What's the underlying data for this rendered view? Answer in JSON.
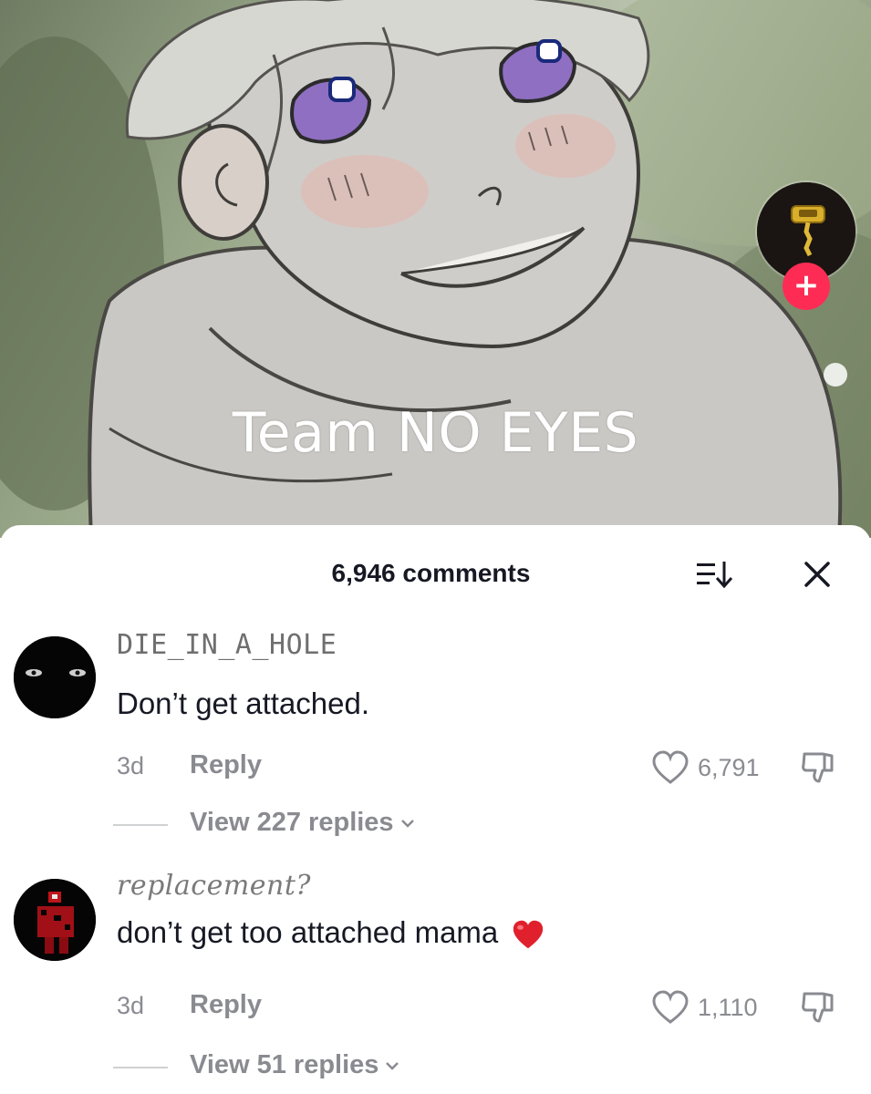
{
  "video": {
    "overlay_text": "Team NO EYES",
    "follow_label": "+"
  },
  "comments_panel": {
    "count_label": "6,946 comments",
    "close_label": "✕"
  },
  "comments": [
    {
      "username": "DIE_IN_A_HOLE",
      "text": "Don’t get attached.",
      "time": "3d",
      "reply_label": "Reply",
      "likes": "6,791",
      "view_replies": "View 227 replies"
    },
    {
      "username": "replacement?",
      "text": "don’t get too attached mama",
      "time": "3d",
      "reply_label": "Reply",
      "likes": "1,110",
      "view_replies": "View 51 replies"
    }
  ],
  "colors": {
    "accent": "#fe2c55",
    "text_primary": "#161823",
    "text_secondary": "#8a8b91"
  },
  "icons": [
    "sort-icon",
    "close-icon",
    "heart-outline-icon",
    "dislike-icon",
    "chevron-down-icon",
    "red-heart-emoji"
  ]
}
